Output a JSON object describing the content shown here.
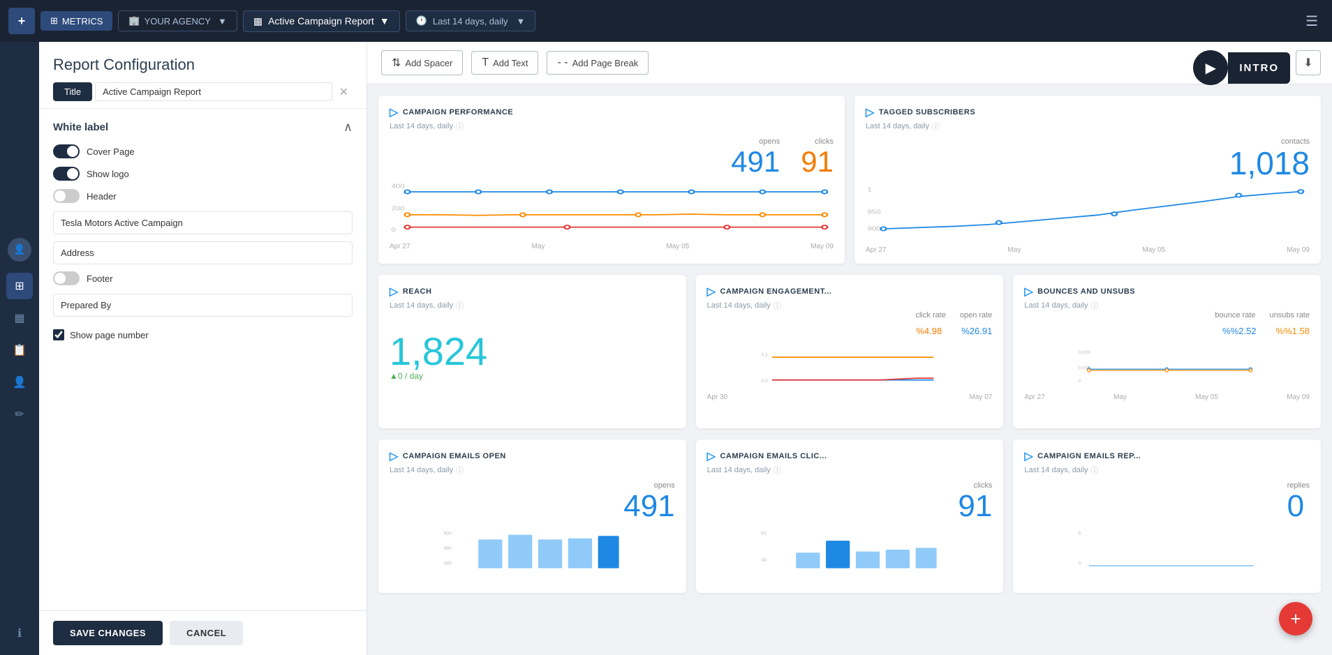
{
  "nav": {
    "logo_symbol": "+",
    "app_name": "METRICS",
    "agency_label": "YOUR AGENCY",
    "report_title": "Active Campaign Report",
    "time_range": "Last 14 days, daily",
    "menu_icon": "☰"
  },
  "sidebar": {
    "icons": [
      {
        "name": "home-icon",
        "symbol": "⊞"
      },
      {
        "name": "dashboard-icon",
        "symbol": "▦"
      },
      {
        "name": "reports-icon",
        "symbol": "📋"
      },
      {
        "name": "users-icon",
        "symbol": "👤"
      },
      {
        "name": "settings-icon",
        "symbol": "✏"
      },
      {
        "name": "info-icon",
        "symbol": "ℹ"
      }
    ]
  },
  "config": {
    "title": "Report Configuration",
    "tab_label": "Title",
    "tab_value": "Active Campaign Report",
    "section_white_label": "White label",
    "toggle_cover_page": {
      "label": "Cover Page",
      "on": true
    },
    "toggle_show_logo": {
      "label": "Show logo",
      "on": true
    },
    "toggle_header": {
      "label": "Header",
      "on": false
    },
    "input_campaign": "Tesla Motors Active Campaign",
    "input_address": "Address",
    "toggle_footer": {
      "label": "Footer",
      "on": false
    },
    "input_prepared_by": "Prepared By",
    "checkbox_page_number": {
      "label": "Show page number",
      "checked": true
    },
    "btn_save": "SAVE CHANGES",
    "btn_cancel": "CANCEL"
  },
  "toolbar": {
    "add_spacer": "Add Spacer",
    "add_text": "Add Text",
    "add_page_break": "Add Page Break",
    "intro_label": "INTRO"
  },
  "cards": {
    "campaign_performance": {
      "title": "CAMPAIGN PERFORMANCE",
      "subtitle": "Last 14 days, daily",
      "metric_opens": "491",
      "metric_clicks": "91",
      "label_opens": "opens",
      "label_clicks": "clicks",
      "dates": [
        "Apr 27",
        "May",
        "May 05",
        "May 09"
      ],
      "y_labels": [
        "400",
        "200",
        "0"
      ]
    },
    "tagged_subscribers": {
      "title": "TAGGED SUBSCRIBERS",
      "subtitle": "Last 14 days, daily",
      "metric_contacts": "1,018",
      "label_contacts": "contacts",
      "dates": [
        "Apr 27",
        "May",
        "May 05",
        "May 09"
      ],
      "y_labels": [
        "1",
        "950",
        "900"
      ]
    },
    "reach": {
      "title": "REACH",
      "subtitle": "Last 14 days, daily",
      "metric": "1,824",
      "per_day": "▲0 / day"
    },
    "campaign_engagement": {
      "title": "CAMPAIGN ENGAGEMENT...",
      "subtitle": "Last 14 days, daily",
      "click_rate": "%4.98",
      "open_rate": "%26.91",
      "label_click": "click rate",
      "label_open": "open rate",
      "dates": [
        "Apr 30",
        "May 07"
      ],
      "y_labels": [
        "0.1",
        "0.0"
      ]
    },
    "bounces_unsubs": {
      "title": "BOUNCES AND UNSUBS",
      "subtitle": "Last 14 days, daily",
      "bounce_rate": "%2.52",
      "unsubs_rate": "%1.58",
      "label_bounce": "bounce rate",
      "label_unsubs": "unsubs rate",
      "dates": [
        "Apr 27",
        "May",
        "May 05",
        "May 09"
      ],
      "y_labels": [
        "0.020",
        "0.015",
        "0"
      ]
    },
    "emails_open": {
      "title": "CAMPAIGN EMAILS OPEN",
      "subtitle": "Last 14 days, daily",
      "metric": "491",
      "label": "opens",
      "dates": [
        ""
      ],
      "y_labels": [
        "500",
        "490",
        "480"
      ]
    },
    "emails_clicks": {
      "title": "CAMPAIGN EMAILS CLIC...",
      "subtitle": "Last 14 days, daily",
      "metric": "91",
      "label": "clicks",
      "y_labels": [
        "91",
        "90"
      ]
    },
    "emails_replies": {
      "title": "CAMPAIGN EMAILS REP...",
      "subtitle": "Last 14 days, daily",
      "metric": "0",
      "label": "replies",
      "y_labels": [
        "5",
        "0"
      ]
    }
  },
  "fab": {
    "symbol": "+"
  }
}
